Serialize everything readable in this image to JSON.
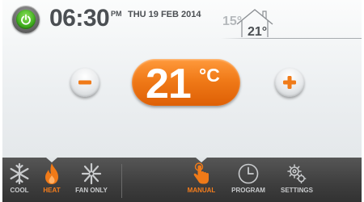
{
  "status": {
    "time": "06:30",
    "ampm": "PM",
    "date": "THU 19 FEB 2014",
    "outdoor_temp": "15°",
    "indoor_temp": "21°"
  },
  "thermostat": {
    "set_temperature": "21",
    "unit": "°C"
  },
  "modes": {
    "cool_label": "COOL",
    "heat_label": "HEAT",
    "fan_label": "FAN ONLY",
    "active": "HEAT"
  },
  "nav": {
    "manual_label": "MANUAL",
    "program_label": "PROGRAM",
    "settings_label": "SETTINGS",
    "active": "MANUAL"
  },
  "colors": {
    "accent": "#f07a18",
    "power": "#3fae1e",
    "bar": "#3e3e3e"
  },
  "icons": {
    "power": "power-icon",
    "outdoor_house": "house-icon",
    "minus": "minus-icon",
    "plus": "plus-icon",
    "cool": "snowflake-icon",
    "heat": "flame-icon",
    "fan": "fan-icon",
    "manual": "hand-pointer-icon",
    "program": "clock-icon",
    "settings": "gear-icon"
  }
}
